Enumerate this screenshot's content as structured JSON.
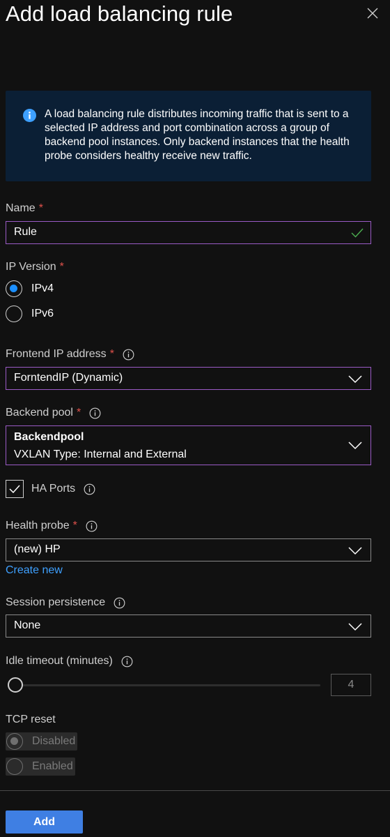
{
  "panel": {
    "title": "Add load balancing rule",
    "info_text": "A load balancing rule distributes incoming traffic that is sent to a selected IP address and port combination across a group of backend pool instances. Only backend instances that the health probe considers healthy receive new traffic."
  },
  "fields": {
    "name": {
      "label": "Name",
      "required": "*",
      "value": "Rule"
    },
    "ip_version": {
      "label": "IP Version",
      "required": "*",
      "options": [
        {
          "label": "IPv4",
          "selected": true
        },
        {
          "label": "IPv6",
          "selected": false
        }
      ]
    },
    "frontend_ip": {
      "label": "Frontend IP address",
      "required": "*",
      "value": "ForntendIP (Dynamic)"
    },
    "backend_pool": {
      "label": "Backend pool",
      "required": "*",
      "value_title": "Backendpool",
      "value_subtitle": "VXLAN Type: Internal and External"
    },
    "ha_ports": {
      "label": "HA Ports",
      "checked": true
    },
    "health_probe": {
      "label": "Health probe",
      "required": "*",
      "value": "(new) HP",
      "create_new": "Create new"
    },
    "session_persistence": {
      "label": "Session persistence",
      "value": "None"
    },
    "idle_timeout": {
      "label": "Idle timeout (minutes)",
      "value": "4"
    },
    "tcp_reset": {
      "label": "TCP reset",
      "options": [
        {
          "label": "Disabled",
          "selected": true
        },
        {
          "label": "Enabled",
          "selected": false
        }
      ]
    }
  },
  "footer": {
    "add_label": "Add"
  },
  "colors": {
    "background": "#111111",
    "accent": "#1b8fff",
    "focus_border": "#9b5bc6",
    "required": "#e0514b",
    "link": "#3ea0ff",
    "primary_button": "#3f7fe3",
    "info_box": "#0b1f35"
  }
}
